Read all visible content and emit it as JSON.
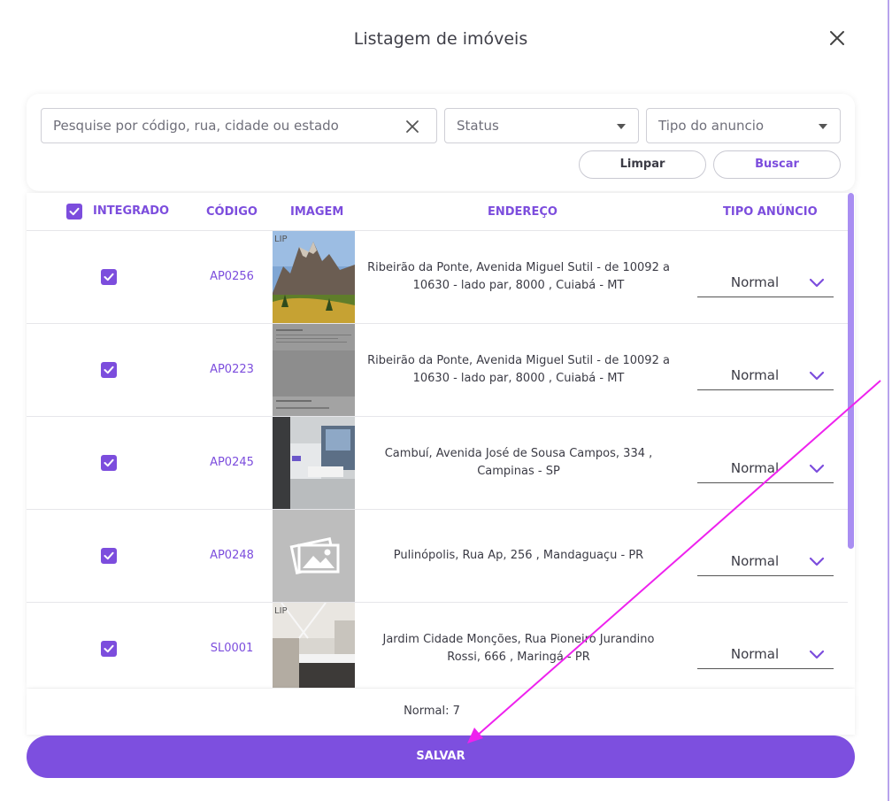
{
  "dialog": {
    "title": "Listagem de imóveis"
  },
  "filters": {
    "search_placeholder": "Pesquise por código, rua, cidade ou estado",
    "status_label": "Status",
    "tipo_label": "Tipo do anuncio",
    "clear_label": "Limpar",
    "search_label": "Buscar"
  },
  "table": {
    "headers": {
      "integrado": "INTEGRADO",
      "codigo": "CÓDIGO",
      "imagem": "IMAGEM",
      "endereco": "ENDEREÇO",
      "tipo": "TIPO ANÚNCIO"
    },
    "rows": [
      {
        "code": "AP0256",
        "address_line1": "Ribeirão da Ponte, Avenida Miguel Sutil - de 10092 a",
        "address_line2": "10630 - lado par, 8000 , Cuiabá - MT",
        "tipo": "Normal",
        "checked": true,
        "image": "mountain-landscape"
      },
      {
        "code": "AP0223",
        "address_line1": "Ribeirão da Ponte, Avenida Miguel Sutil - de 10092 a",
        "address_line2": "10630 - lado par, 8000 , Cuiabá - MT",
        "tipo": "Normal",
        "checked": true,
        "image": "screenshot-gray"
      },
      {
        "code": "AP0245",
        "address_line1": "Cambuí, Avenida José de Sousa Campos, 334 ,",
        "address_line2": "Campinas - SP",
        "tipo": "Normal",
        "checked": true,
        "image": "bathroom-interior"
      },
      {
        "code": "AP0248",
        "address_line1": "Pulinópolis, Rua Ap, 256 , Mandaguaçu - PR",
        "address_line2": "",
        "tipo": "Normal",
        "checked": true,
        "image": "image-placeholder"
      },
      {
        "code": "SL0001",
        "address_line1": "Jardim Cidade Monções, Rua Pioneiro Jurandino",
        "address_line2": "Rossi, 666 , Maringá - PR",
        "tipo": "Normal",
        "checked": true,
        "image": "bathroom-vanity"
      }
    ]
  },
  "footer": {
    "summary": "Normal: 7"
  },
  "save_label": "SALVAR",
  "colors": {
    "accent": "#7d4fdf",
    "annotation": "#ee22ee"
  },
  "thumb_badge": "LIP"
}
